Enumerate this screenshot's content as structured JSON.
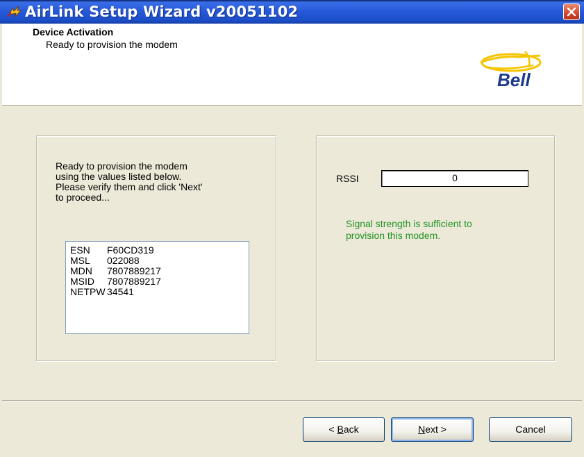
{
  "window": {
    "title": "AirLink Setup Wizard v20051102"
  },
  "header": {
    "title": "Device Activation",
    "subtitle": "Ready to provision the modem",
    "logo_text": "Bell",
    "logo_color": "#f5c400"
  },
  "left_panel": {
    "intro_lines": [
      "Ready to provision the modem",
      "using the values listed below.",
      "Please verify them and click 'Next'",
      "to proceed..."
    ],
    "values": [
      {
        "key": "ESN",
        "value": "F60CD319"
      },
      {
        "key": "MSL",
        "value": "022088"
      },
      {
        "key": "MDN",
        "value": "7807889217"
      },
      {
        "key": "MSID",
        "value": "7807889217"
      },
      {
        "key": "NETPW",
        "value": "34541"
      }
    ]
  },
  "right_panel": {
    "rssi_label": "RSSI",
    "rssi_value": "0",
    "signal_lines": [
      "Signal strength is sufficient to",
      "provision this modem."
    ],
    "signal_color": "#219323"
  },
  "buttons": {
    "back": {
      "mnemonic": "B",
      "rest": "ack",
      "prefix": "< "
    },
    "next": {
      "mnemonic": "N",
      "rest": "ext >"
    },
    "cancel": "Cancel"
  }
}
